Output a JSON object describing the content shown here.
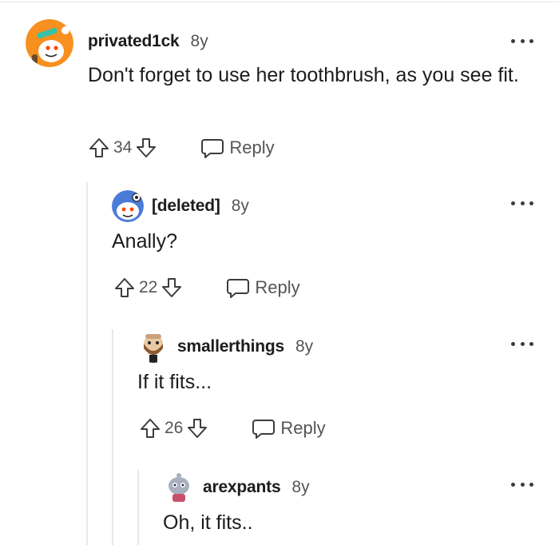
{
  "comments": [
    {
      "username": "privated1ck",
      "age": "8y",
      "body": "Don't forget to use her toothbrush, as you see fit.",
      "score": "34",
      "reply_label": "Reply",
      "avatar_colors": {
        "bg": "#f7901e",
        "face": "#ffffff"
      }
    },
    {
      "username": "[deleted]",
      "age": "8y",
      "body": "Anally?",
      "score": "22",
      "reply_label": "Reply",
      "avatar_colors": {
        "bg": "#4b7bd8",
        "face": "#ffffff"
      }
    },
    {
      "username": "smallerthings",
      "age": "8y",
      "body": "If it fits...",
      "score": "26",
      "reply_label": "Reply",
      "avatar_colors": {
        "bg": "#ffffff",
        "face": "#c9a27c"
      }
    },
    {
      "username": "arexpants",
      "age": "8y",
      "body": "Oh, it fits..",
      "avatar_colors": {
        "bg": "#ffffff",
        "face": "#a7b0bf"
      }
    }
  ]
}
